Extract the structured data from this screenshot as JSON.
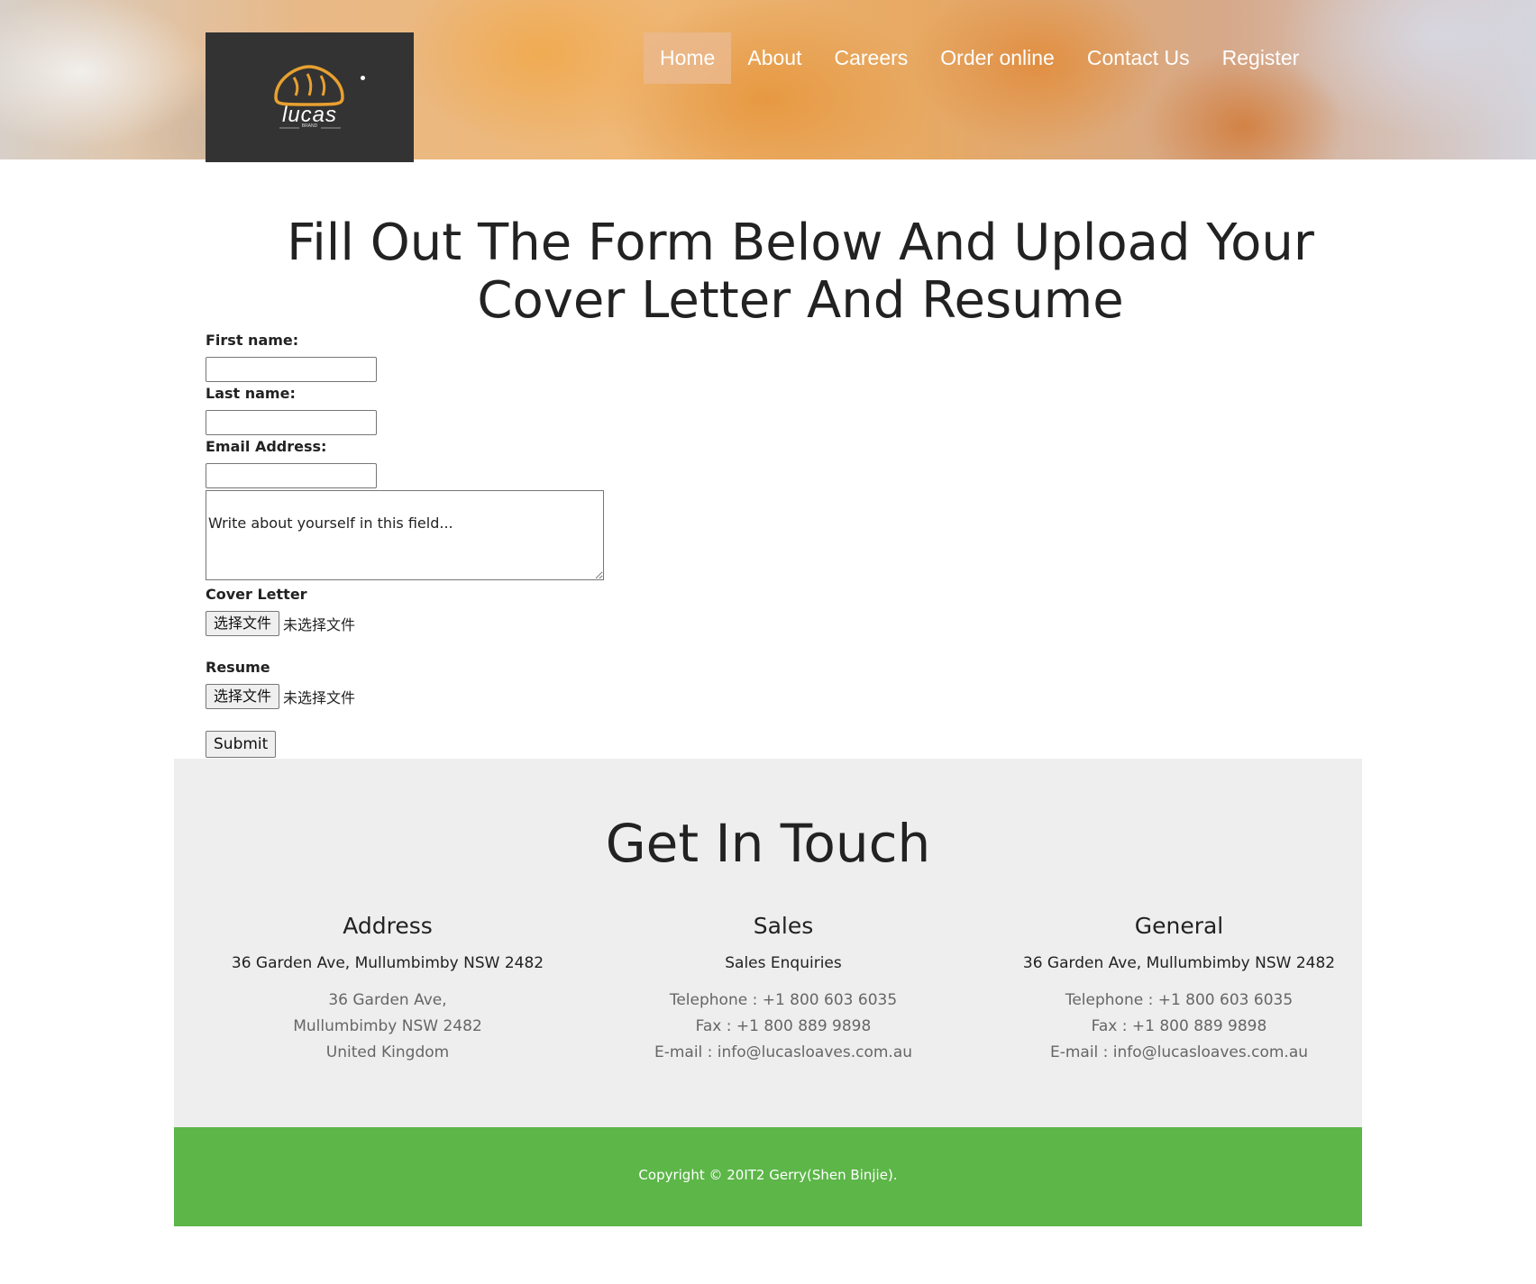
{
  "header": {
    "logo_text": "lucas",
    "logo_sub": "BRAND",
    "nav": [
      {
        "label": "Home"
      },
      {
        "label": "About"
      },
      {
        "label": "Careers"
      },
      {
        "label": "Order online"
      },
      {
        "label": "Contact Us"
      },
      {
        "label": "Register"
      }
    ]
  },
  "form": {
    "title": "Fill Out The Form Below And Upload Your Cover Letter And Resume",
    "first_name_label": "First name:",
    "first_name_value": "",
    "last_name_label": "Last name:",
    "last_name_value": "",
    "email_label": "Email Address:",
    "email_value": "",
    "about_value": "Write about yourself in this field...",
    "cover_letter_label": "Cover Letter",
    "resume_label": "Resume",
    "file_button": "选择文件",
    "file_status": "未选择文件",
    "submit_label": "Submit"
  },
  "contact": {
    "title": "Get In Touch",
    "columns": [
      {
        "heading": "Address",
        "strong": "36 Garden Ave, Mullumbimby NSW 2482",
        "lines": [
          "36 Garden Ave,",
          "Mullumbimby NSW 2482",
          "United Kingdom"
        ]
      },
      {
        "heading": "Sales",
        "strong": "Sales Enquiries",
        "lines": [
          "Telephone : +1 800 603 6035",
          "Fax : +1 800 889 9898",
          "E-mail : info@lucasloaves.com.au"
        ]
      },
      {
        "heading": "General",
        "strong": "36 Garden Ave, Mullumbimby NSW 2482",
        "lines": [
          "Telephone : +1 800 603 6035",
          "Fax : +1 800 889 9898",
          "E-mail : info@lucasloaves.com.au"
        ]
      }
    ]
  },
  "footer": {
    "copyright": "Copyright © 20IT2 Gerry(Shen Binjie)."
  },
  "colors": {
    "footer_green": "#5cb648",
    "contact_bg": "#eeeeee",
    "logo_bg": "#333333",
    "logo_accent": "#e8a030"
  }
}
